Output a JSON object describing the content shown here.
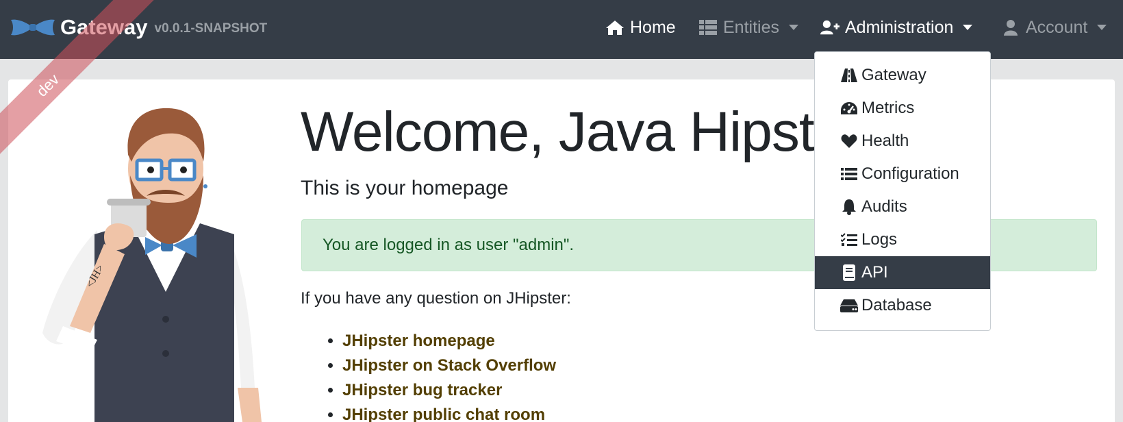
{
  "brand": {
    "title": "Gateway",
    "version": "v0.0.1-SNAPSHOT"
  },
  "ribbon": {
    "label": "dev"
  },
  "nav": {
    "home": "Home",
    "entities": "Entities",
    "administration": "Administration",
    "account": "Account"
  },
  "admin_menu": {
    "items": [
      {
        "label": "Gateway",
        "icon": "road-icon"
      },
      {
        "label": "Metrics",
        "icon": "tachometer-icon"
      },
      {
        "label": "Health",
        "icon": "heart-icon"
      },
      {
        "label": "Configuration",
        "icon": "list-icon"
      },
      {
        "label": "Audits",
        "icon": "bell-icon"
      },
      {
        "label": "Logs",
        "icon": "tasks-icon"
      },
      {
        "label": "API",
        "icon": "book-icon",
        "active": true
      },
      {
        "label": "Database",
        "icon": "hdd-icon"
      }
    ]
  },
  "main": {
    "title": "Welcome, Java Hipster!",
    "subtitle": "This is your homepage",
    "alert": "You are logged in as user \"admin\".",
    "question": "If you have any question on JHipster:",
    "links": [
      "JHipster homepage",
      "JHipster on Stack Overflow",
      "JHipster bug tracker",
      "JHipster public chat room"
    ]
  },
  "colors": {
    "navbar": "#353d47",
    "alert_bg": "#d4edda",
    "alert_text": "#155724",
    "link": "#533f03",
    "active_item": "#353d47"
  }
}
